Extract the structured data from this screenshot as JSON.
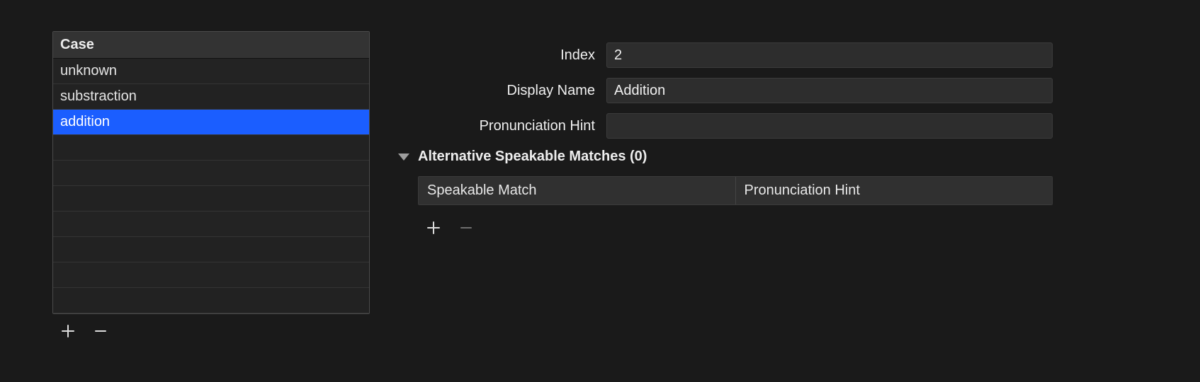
{
  "caseTable": {
    "header": "Case",
    "rows": [
      {
        "label": "unknown",
        "selected": false
      },
      {
        "label": "substraction",
        "selected": false
      },
      {
        "label": "addition",
        "selected": true
      }
    ],
    "emptyRows": 7
  },
  "fields": {
    "indexLabel": "Index",
    "indexValue": "2",
    "displayNameLabel": "Display Name",
    "displayNameValue": "Addition",
    "pronHintLabel": "Pronunciation Hint",
    "pronHintValue": ""
  },
  "altSection": {
    "title": "Alternative Speakable Matches (0)",
    "col1": "Speakable Match",
    "col2": "Pronunciation Hint"
  },
  "icons": {
    "plus": "+",
    "minus": "−"
  }
}
